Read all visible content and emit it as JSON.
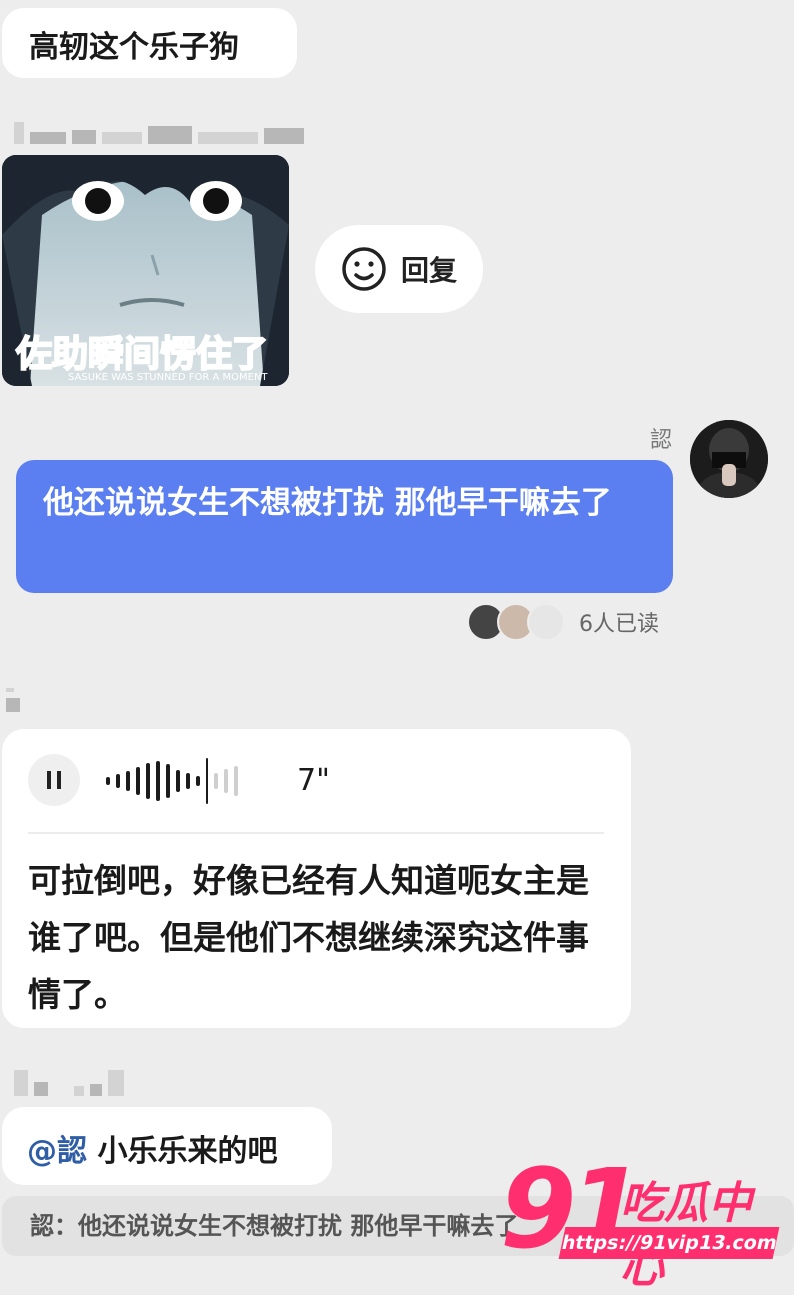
{
  "messages": {
    "top_text": "高轫这个乐子狗",
    "sticker": {
      "caption_cn": "佐助瞬间愣住了",
      "caption_en": "SASUKE WAS STUNNED FOR A MOMENT"
    },
    "reply_button": {
      "label": "回复",
      "icon": "smiley-face-icon"
    },
    "outgoing": {
      "sender": "認",
      "text": "他还说说女生不想被打扰 那他早干嘛去了",
      "read_receipt": "6人已读"
    },
    "voice": {
      "duration": "7\"",
      "transcript": "可拉倒吧，好像已经有人知道呃女主是谁了吧。但是他们不想继续深究这件事情了。"
    },
    "mention_reply": {
      "mention": "@認",
      "text": " 小乐乐来的吧"
    },
    "quote": "認：他还说说女生不想被打扰 那他早干嘛去了"
  },
  "watermark": {
    "number": "91",
    "brand": "吃瓜中心",
    "url": "https://91vip13.com"
  },
  "colors": {
    "background": "#ededed",
    "outgoing_bubble": "#5b7ff0",
    "watermark": "#ff2e6e"
  }
}
